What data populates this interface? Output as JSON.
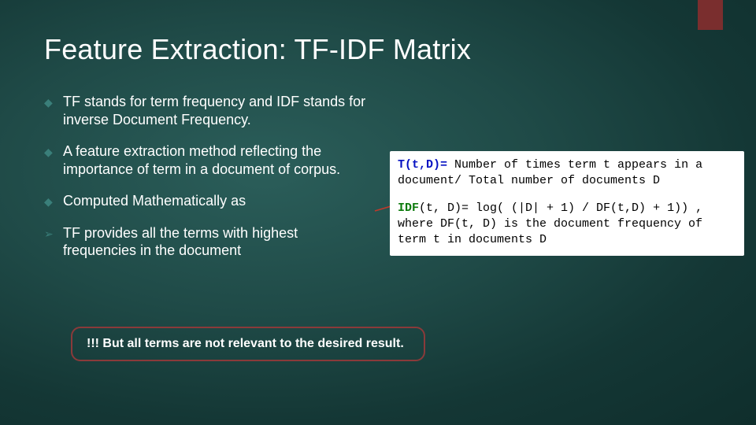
{
  "title": "Feature Extraction: TF-IDF Matrix",
  "bullets": [
    {
      "glyph": "◆",
      "text": "TF stands for term frequency and IDF stands for  inverse Document Frequency."
    },
    {
      "glyph": "◆",
      "text": "A feature extraction method reflecting the importance of term in a document of corpus."
    },
    {
      "glyph": "◆",
      "text": "Computed Mathematically as"
    },
    {
      "glyph": "➢",
      "text": " TF provides all the terms with highest frequencies in the document"
    }
  ],
  "formula": {
    "tf_label": "T(t,D)=",
    "tf_rest": " Number of times term t appears in a document/ Total number of documents D",
    "idf_label": "IDF",
    "idf_rest": "(t, D)= log( (|D| + 1) / DF(t,D) + 1)) , where DF(t, D) is the document frequency of term t in documents D"
  },
  "note": "!!! But all terms are not relevant to the desired result."
}
